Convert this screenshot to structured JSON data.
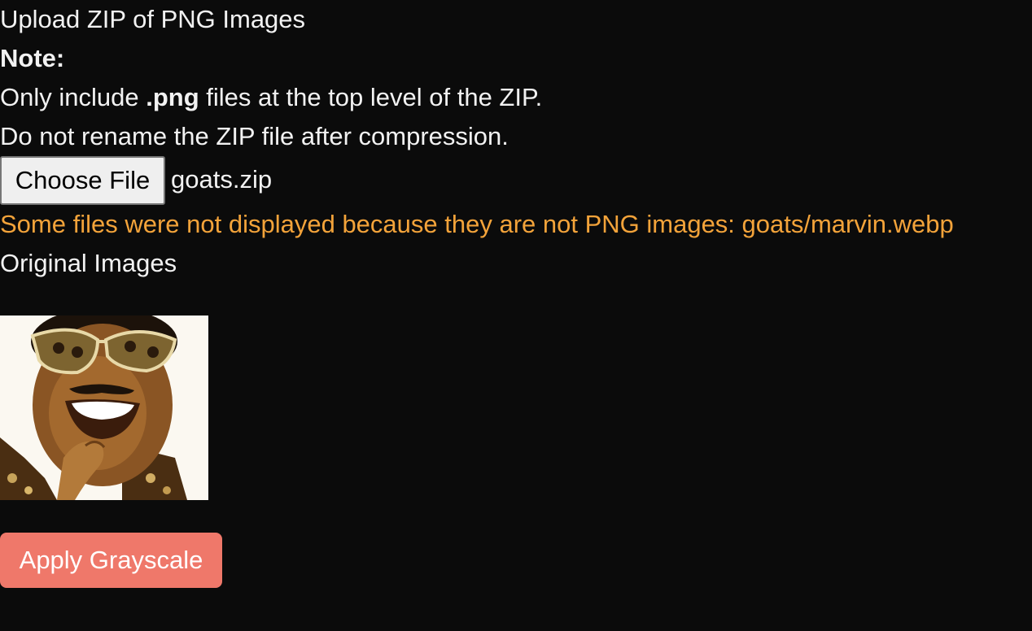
{
  "page": {
    "heading": "Upload ZIP of PNG Images",
    "note_label": "Note:",
    "note_line1_prefix": "Only include ",
    "note_line1_bold": ".png",
    "note_line1_suffix": " files at the top level of the ZIP.",
    "note_line2": "Do not rename the ZIP file after compression."
  },
  "file_input": {
    "button_label": "Choose File",
    "selected_file": "goats.zip"
  },
  "warning": {
    "text": "Some files were not displayed because they are not PNG images: goats/marvin.webp",
    "color": "#f3a33a"
  },
  "original_images": {
    "title": "Original Images"
  },
  "actions": {
    "apply_label": "Apply Grayscale",
    "apply_color": "#ef786a"
  }
}
